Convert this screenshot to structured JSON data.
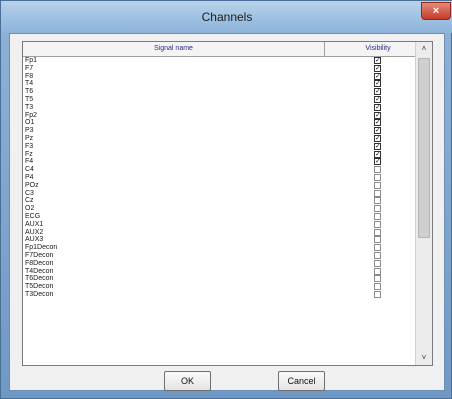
{
  "window": {
    "title": "Channels",
    "close_glyph": "×"
  },
  "list": {
    "columns": {
      "name": "Signal name",
      "visibility": "Visibility"
    },
    "rows": [
      {
        "name": "Fp1",
        "visible": true
      },
      {
        "name": "F7",
        "visible": true
      },
      {
        "name": "F8",
        "visible": true
      },
      {
        "name": "T4",
        "visible": true
      },
      {
        "name": "T6",
        "visible": true
      },
      {
        "name": "T5",
        "visible": true
      },
      {
        "name": "T3",
        "visible": true
      },
      {
        "name": "Fp2",
        "visible": true
      },
      {
        "name": "O1",
        "visible": true
      },
      {
        "name": "P3",
        "visible": true
      },
      {
        "name": "Pz",
        "visible": true
      },
      {
        "name": "F3",
        "visible": true
      },
      {
        "name": "Fz",
        "visible": true
      },
      {
        "name": "F4",
        "visible": true
      },
      {
        "name": "C4",
        "visible": false
      },
      {
        "name": "P4",
        "visible": false
      },
      {
        "name": "POz",
        "visible": false
      },
      {
        "name": "C3",
        "visible": false
      },
      {
        "name": "Cz",
        "visible": false
      },
      {
        "name": "O2",
        "visible": false
      },
      {
        "name": "ECG",
        "visible": false
      },
      {
        "name": "AUX1",
        "visible": false
      },
      {
        "name": "AUX2",
        "visible": false
      },
      {
        "name": "AUX3",
        "visible": false
      },
      {
        "name": "Fp1Decon",
        "visible": false
      },
      {
        "name": "F7Decon",
        "visible": false
      },
      {
        "name": "F8Decon",
        "visible": false
      },
      {
        "name": "T4Decon",
        "visible": false
      },
      {
        "name": "T6Decon",
        "visible": false
      },
      {
        "name": "T5Decon",
        "visible": false
      },
      {
        "name": "T3Decon",
        "visible": false
      }
    ],
    "scroll_up_glyph": "˄",
    "scroll_down_glyph": "˅",
    "check_glyph": "✓"
  },
  "buttons": {
    "ok": "OK",
    "cancel": "Cancel"
  }
}
